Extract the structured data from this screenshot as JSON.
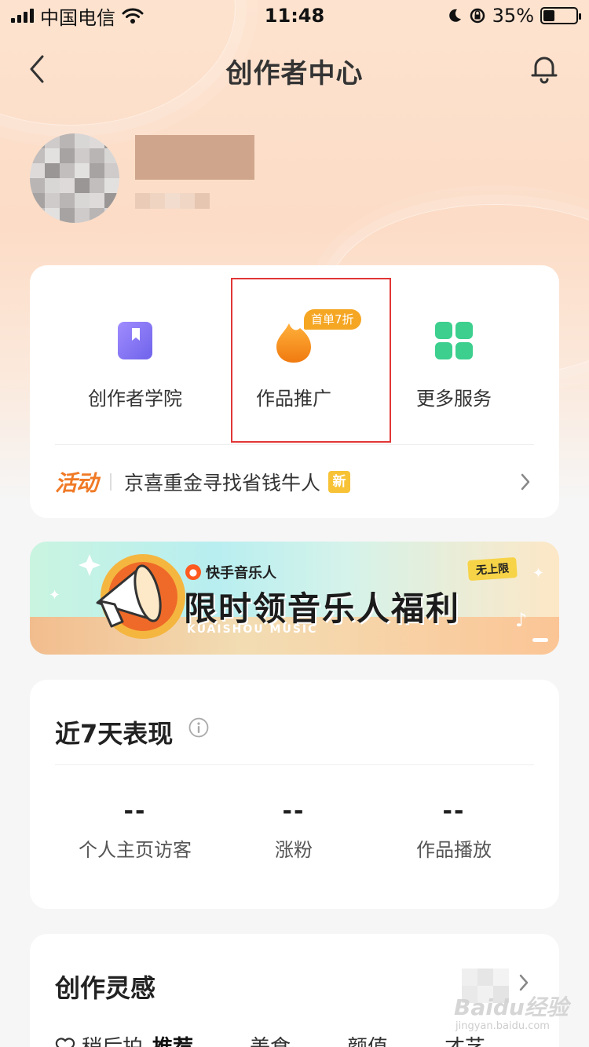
{
  "status_bar": {
    "carrier": "中国电信",
    "time": "11:48",
    "battery": "35%",
    "battery_level": 0.35
  },
  "header": {
    "title": "创作者中心"
  },
  "services": {
    "items": [
      {
        "label": "创作者学院",
        "icon": "bookmark-book-icon",
        "color": "#8b7bf5"
      },
      {
        "label": "作品推广",
        "icon": "flame-icon",
        "color": "#f5a623",
        "badge": "首单7折"
      },
      {
        "label": "更多服务",
        "icon": "grid-apps-icon",
        "color": "#3ccf8e"
      }
    ],
    "activity": {
      "tag": "活动",
      "text": "京喜重金寻找省钱牛人",
      "new_badge": "新"
    }
  },
  "banner": {
    "brand": "快手音乐人",
    "title": "限时领音乐人福利",
    "subtitle": "KUAISHOU MUSIC",
    "tag": "无上限"
  },
  "performance": {
    "title": "近7天表现",
    "metrics": [
      {
        "value": "--",
        "label": "个人主页访客"
      },
      {
        "value": "--",
        "label": "涨粉"
      },
      {
        "value": "--",
        "label": "作品播放"
      }
    ]
  },
  "inspiration": {
    "title": "创作灵感",
    "tabs": [
      "稍后拍",
      "推荐",
      "美食",
      "颜值",
      "才艺"
    ]
  },
  "watermark": {
    "text": "Baidu经验",
    "sub": "jingyan.baidu.com"
  },
  "colors": {
    "accent_orange": "#f07a26",
    "highlight_red": "#e23636",
    "badge_yellow": "#f5a623"
  }
}
